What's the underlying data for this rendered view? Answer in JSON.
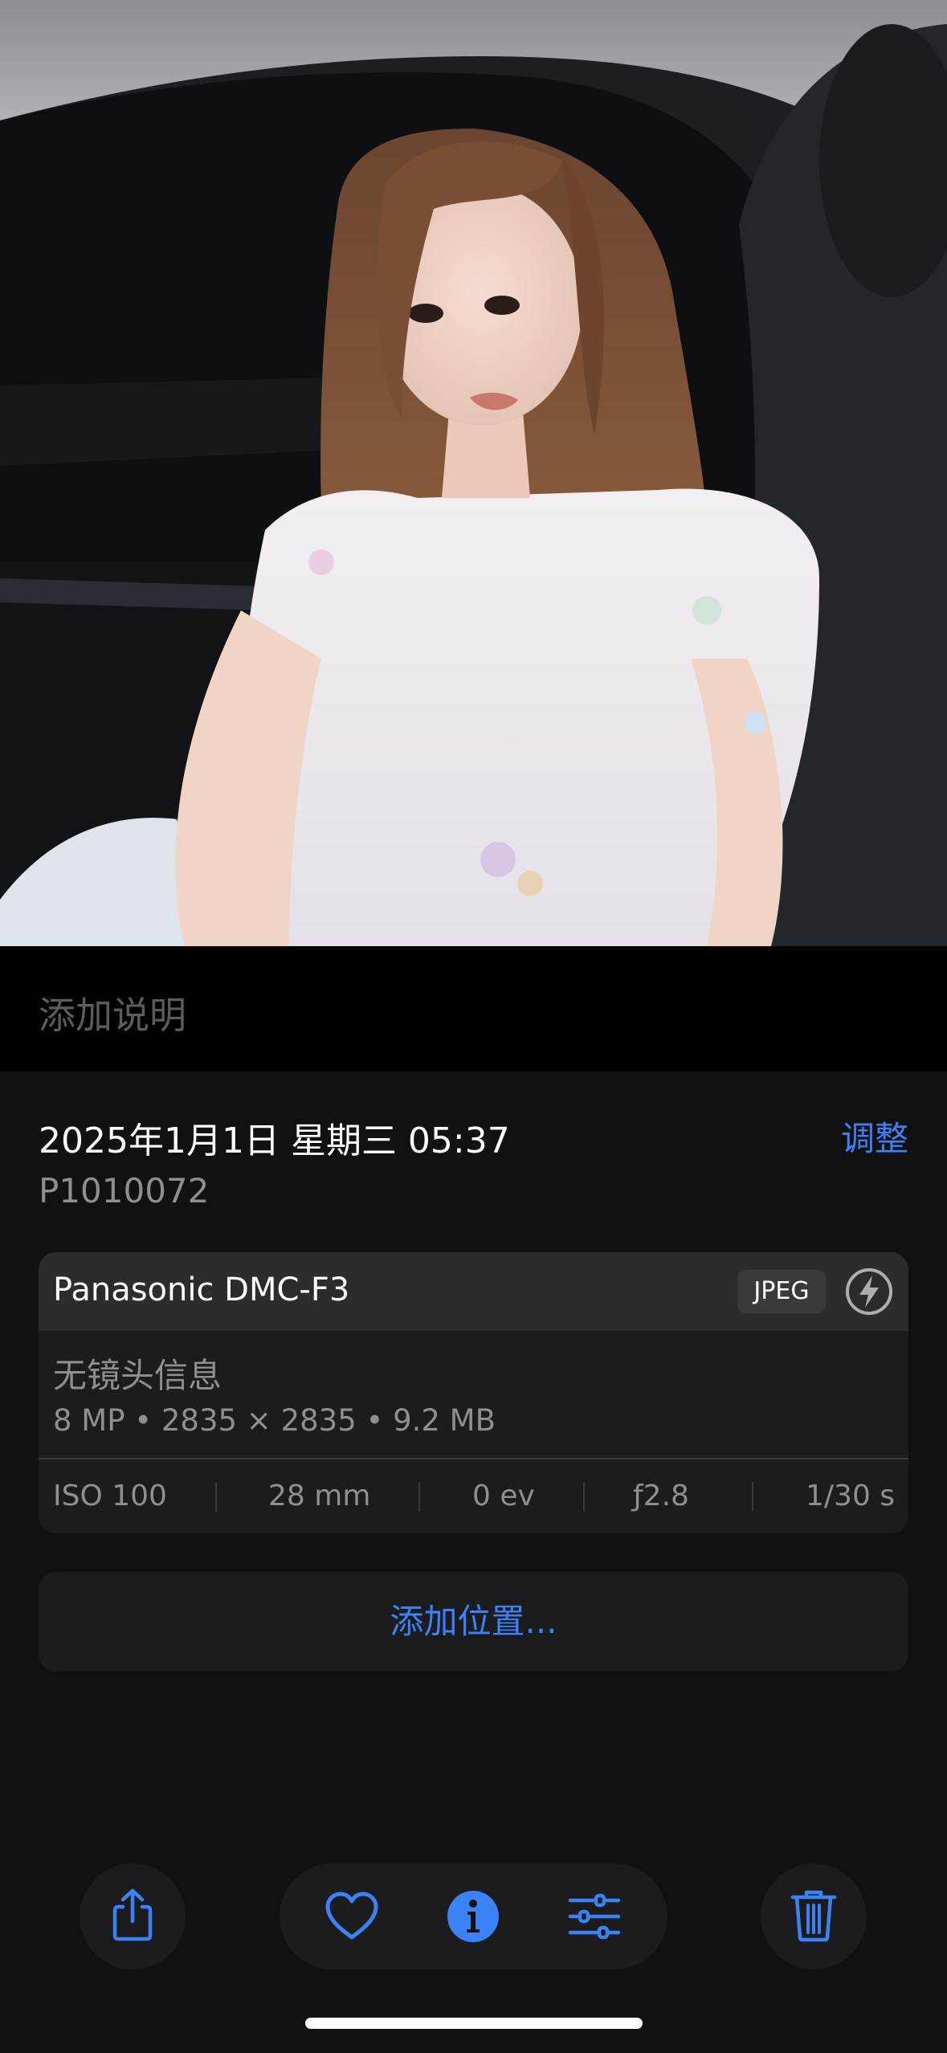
{
  "caption": {
    "placeholder": "添加说明"
  },
  "info": {
    "date": "2025年1月1日 星期三 05:37",
    "adjust_label": "调整",
    "filename": "P1010072"
  },
  "camera": {
    "model": "Panasonic DMC-F3",
    "format": "JPEG",
    "lens": "无镜头信息",
    "specs": "8 MP • 2835 × 2835 • 9.2 MB",
    "exif": {
      "iso": "ISO 100",
      "focal": "28 mm",
      "exposure": "0 ev",
      "aperture": "ƒ2.8",
      "shutter": "1/30 s"
    }
  },
  "location": {
    "label": "添加位置..."
  },
  "toolbar": {
    "icons": [
      "share-icon",
      "heart-icon",
      "info-icon",
      "sliders-icon",
      "trash-icon"
    ]
  },
  "colors": {
    "accent": "#3b82f6",
    "background": "#111111",
    "card": "#1c1c1e",
    "secondary_text": "#8e8e93"
  }
}
